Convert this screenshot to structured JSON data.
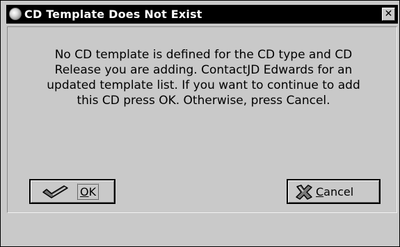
{
  "window": {
    "title": "CD Template Does Not Exist",
    "title_icon": "globe-icon",
    "close_glyph": "✕"
  },
  "message": {
    "lines": [
      "No CD template is defined for the CD type and CD",
      "Release you are adding.  ContactJD Edwards for an",
      "updated template list.  If you want to continue to add",
      "this CD press OK.  Otherwise, press Cancel."
    ]
  },
  "buttons": {
    "ok": {
      "mnemonic": "O",
      "rest": "K",
      "icon": "checkmark-icon"
    },
    "cancel": {
      "mnemonic": "C",
      "rest": "ancel",
      "icon": "x-icon"
    }
  },
  "colors": {
    "dialog_bg": "#c9c9c9",
    "titlebar_bg": "#000000",
    "titlebar_text": "#ffffff"
  }
}
